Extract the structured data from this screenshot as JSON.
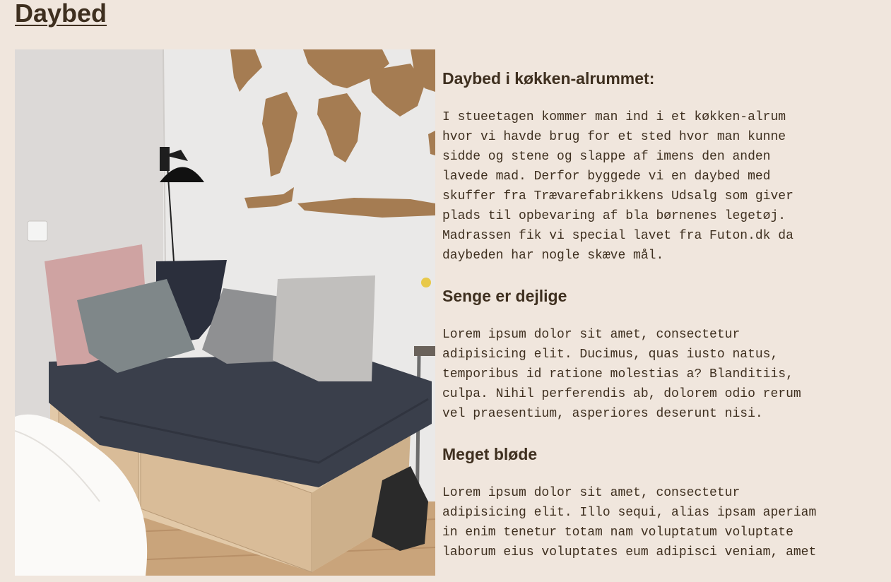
{
  "page": {
    "title": "Daybed"
  },
  "image": {
    "subject": "daybed-photo"
  },
  "sections": [
    {
      "heading": "Daybed i køkken-alrummet:",
      "text": "I stueetagen kommer man ind i et køkken-alrum\nhvor vi havde brug for et sted hvor man kunne\nsidde og stene og slappe af imens den anden\nlavede mad. Derfor byggede vi en daybed med\nskuffer fra Trævarefabrikkens Udsalg som giver\nplads til opbevaring af bla børnenes legetøj.\nMadrassen fik vi special lavet fra Futon.dk da\ndaybeden har nogle skæve mål."
    },
    {
      "heading": "Senge er dejlige",
      "text": "Lorem ipsum dolor sit amet, consectetur\nadipisicing elit. Ducimus, quas iusto natus,\ntemporibus id ratione molestias a? Blanditiis,\nculpa. Nihil perferendis ab, dolorem odio rerum\nvel praesentium, asperiores deserunt nisi."
    },
    {
      "heading": "Meget bløde",
      "text": "Lorem ipsum dolor sit amet, consectetur\nadipisicing elit. Illo sequi, alias ipsam aperiam\nin enim tenetur totam nam voluptatum voluptate\nlaborum eius voluptates eum adipisci veniam, amet"
    }
  ],
  "colors": {
    "background": "#f0e6dd",
    "text": "#3e2f1f"
  }
}
